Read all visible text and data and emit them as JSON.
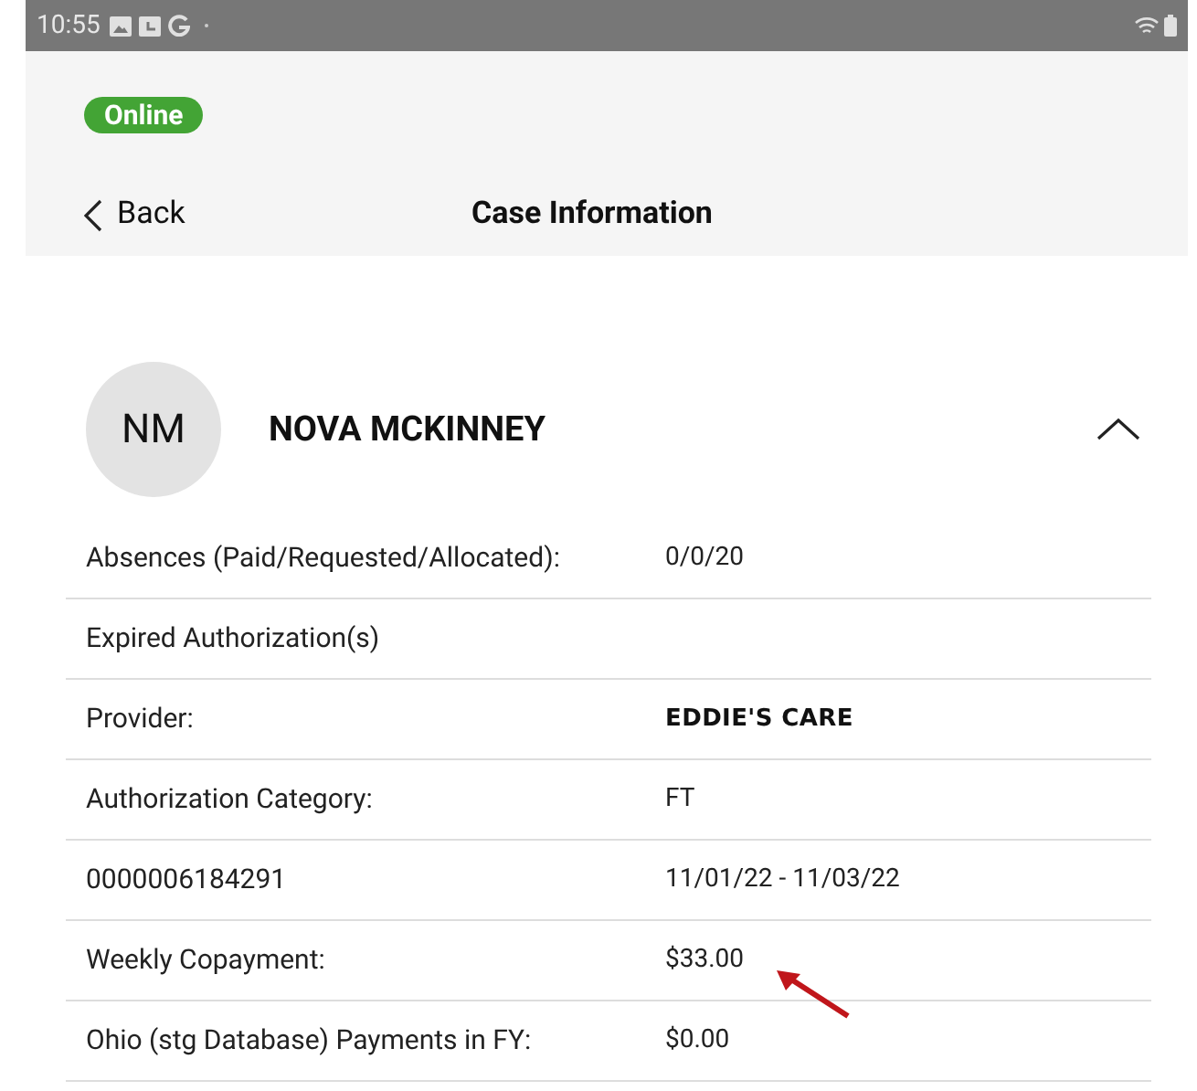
{
  "status_bar": {
    "time": "10:55"
  },
  "connection": {
    "label": "Online",
    "online": true
  },
  "nav": {
    "back": "Back",
    "title": "Case Information"
  },
  "child": {
    "initials": "NM",
    "name": "NOVA MCKINNEY",
    "expanded": true,
    "rows": [
      {
        "label": "Absences (Paid/Requested/Allocated):",
        "value": "0/0/20",
        "emphasis": false
      },
      {
        "label": "Expired Authorization(s)"
      },
      {
        "label": "Provider:",
        "value": "EDDIE'S CARE",
        "emphasis": true
      },
      {
        "label": "Authorization Category:",
        "value": "FT",
        "emphasis": false
      },
      {
        "label": "0000006184291",
        "value": "11/01/22 - 11/03/22",
        "emphasis": false
      },
      {
        "label": "Weekly Copayment:",
        "value": "$33.00",
        "emphasis": false,
        "annotated": true
      },
      {
        "label": "Ohio (stg Database) Payments in FY:",
        "value": "$0.00",
        "emphasis": false
      }
    ]
  }
}
